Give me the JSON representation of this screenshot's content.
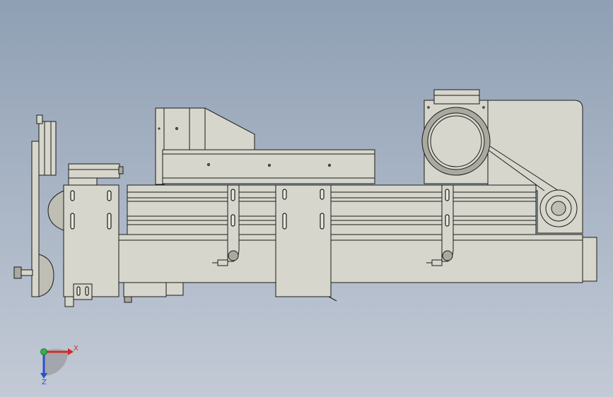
{
  "viewport": {
    "background_top": "#8fa0b4",
    "background_bottom": "#c3cad6"
  },
  "model": {
    "part_color": "#d6d6cc",
    "edge_color": "#1c1c1c"
  },
  "triad": {
    "x_label": "X",
    "z_label": "Z",
    "x_color": "#d42a2a",
    "y_color": "#2fb24a",
    "z_color": "#2a4fd4"
  }
}
